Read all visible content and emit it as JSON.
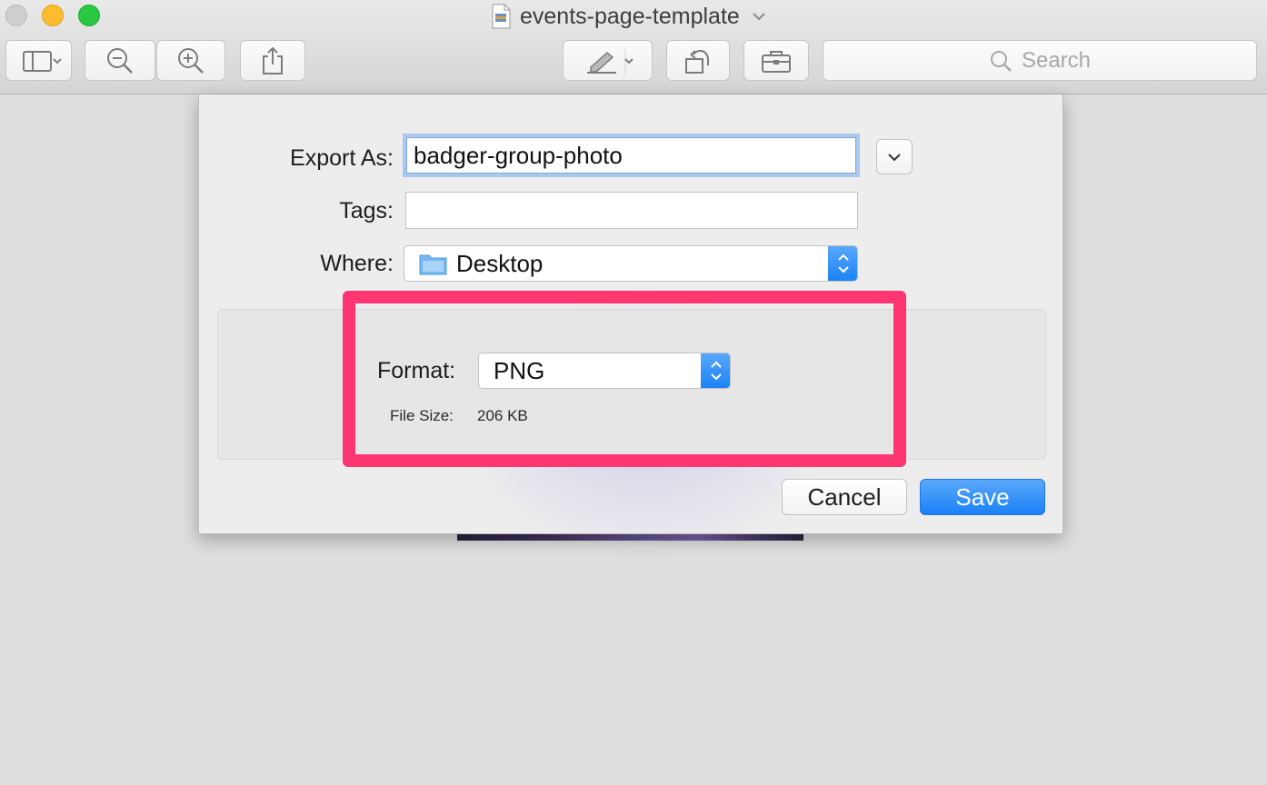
{
  "window": {
    "title": "events-page-template"
  },
  "toolbar": {
    "search_placeholder": "Search"
  },
  "export_sheet": {
    "export_as_label": "Export As:",
    "export_as_value": "badger-group-photo",
    "tags_label": "Tags:",
    "tags_value": "",
    "where_label": "Where:",
    "where_value": "Desktop",
    "format_label": "Format:",
    "format_value": "PNG",
    "file_size_label": "File Size:",
    "file_size_value": "206 KB",
    "cancel_label": "Cancel",
    "save_label": "Save"
  },
  "colors": {
    "accent_blue": "#1a82f7",
    "highlight_pink": "#fd3570",
    "traffic_close": "#cfcfcf",
    "traffic_minimize": "#fdbc2e",
    "traffic_zoom": "#2ac840"
  }
}
